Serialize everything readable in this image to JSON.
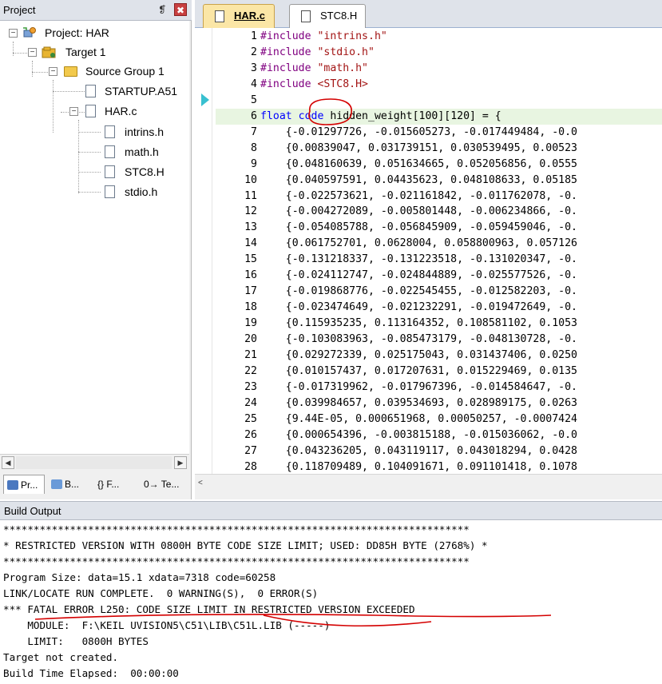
{
  "project_panel": {
    "title": "Project",
    "pin_icon": "❡",
    "close_icon": "✖",
    "tree": {
      "project": "Project: HAR",
      "target": "Target 1",
      "group": "Source Group 1",
      "startup": "STARTUP.A51",
      "har": "HAR.c",
      "includes": [
        "intrins.h",
        "math.h",
        "STC8.H",
        "stdio.h"
      ]
    },
    "tabs": [
      "Pr...",
      "B...",
      "{} F...",
      "0→ Te..."
    ]
  },
  "editor": {
    "tabs": [
      "HAR.c",
      "STC8.H"
    ],
    "lines": [
      {
        "n": "1",
        "t": "#include \"intrins.h\""
      },
      {
        "n": "2",
        "t": "#include \"stdio.h\""
      },
      {
        "n": "3",
        "t": "#include \"math.h\""
      },
      {
        "n": "4",
        "t": "#include <STC8.H>"
      },
      {
        "n": "5",
        "t": ""
      },
      {
        "n": "6",
        "t": "float code hidden_weight[100][120] = {"
      },
      {
        "n": "7",
        "t": "    {-0.01297726, -0.015605273, -0.017449484, -0.0"
      },
      {
        "n": "8",
        "t": "    {0.00839047, 0.031739151, 0.030539495, 0.00523"
      },
      {
        "n": "9",
        "t": "    {0.048160639, 0.051634665, 0.052056856, 0.0555"
      },
      {
        "n": "10",
        "t": "    {0.040597591, 0.04435623, 0.048108633, 0.05185"
      },
      {
        "n": "11",
        "t": "    {-0.022573621, -0.021161842, -0.011762078, -0."
      },
      {
        "n": "12",
        "t": "    {-0.004272089, -0.005801448, -0.006234866, -0."
      },
      {
        "n": "13",
        "t": "    {-0.054085788, -0.056845909, -0.059459046, -0."
      },
      {
        "n": "14",
        "t": "    {0.061752701, 0.0628004, 0.058800963, 0.057126"
      },
      {
        "n": "15",
        "t": "    {-0.131218337, -0.131223518, -0.131020347, -0."
      },
      {
        "n": "16",
        "t": "    {-0.024112747, -0.024844889, -0.025577526, -0."
      },
      {
        "n": "17",
        "t": "    {-0.019868776, -0.022545455, -0.012582203, -0."
      },
      {
        "n": "18",
        "t": "    {-0.023474649, -0.021232291, -0.019472649, -0."
      },
      {
        "n": "19",
        "t": "    {0.115935235, 0.113164352, 0.108581102, 0.1053"
      },
      {
        "n": "20",
        "t": "    {-0.103083963, -0.085473179, -0.048130728, -0."
      },
      {
        "n": "21",
        "t": "    {0.029272339, 0.025175043, 0.031437406, 0.0250"
      },
      {
        "n": "22",
        "t": "    {0.010157437, 0.017207631, 0.015229469, 0.0135"
      },
      {
        "n": "23",
        "t": "    {-0.017319962, -0.017967396, -0.014584647, -0."
      },
      {
        "n": "24",
        "t": "    {0.039984657, 0.039534693, 0.028989175, 0.0263"
      },
      {
        "n": "25",
        "t": "    {9.44E-05, 0.000651968, 0.00050257, -0.0007424"
      },
      {
        "n": "26",
        "t": "    {0.000654396, -0.003815188, -0.015036062, -0.0"
      },
      {
        "n": "27",
        "t": "    {0.043236205, 0.043119117, 0.043018294, 0.0428"
      },
      {
        "n": "28",
        "t": "    {0.118709489, 0.104091671, 0.091101418, 0.1078"
      }
    ]
  },
  "build_output": {
    "title": "Build Output",
    "lines": [
      "*****************************************************************************",
      "* RESTRICTED VERSION WITH 0800H BYTE CODE SIZE LIMIT; USED: DD85H BYTE (2768%) *",
      "*****************************************************************************",
      "Program Size: data=15.1 xdata=7318 code=60258",
      "LINK/LOCATE RUN COMPLETE.  0 WARNING(S),  0 ERROR(S)",
      "*** FATAL ERROR L250: CODE SIZE LIMIT IN RESTRICTED VERSION EXCEEDED",
      "    MODULE:  F:\\KEIL UVISION5\\C51\\LIB\\C51L.LIB (-----)",
      "    LIMIT:   0800H BYTES",
      "Target not created.",
      "Build Time Elapsed:  00:00:00"
    ]
  },
  "colors": {
    "keyword": "#0000ff",
    "string": "#a31515",
    "preprocessor": "#800080",
    "annotation": "#d40000",
    "current_line": "#e8f5e1"
  }
}
